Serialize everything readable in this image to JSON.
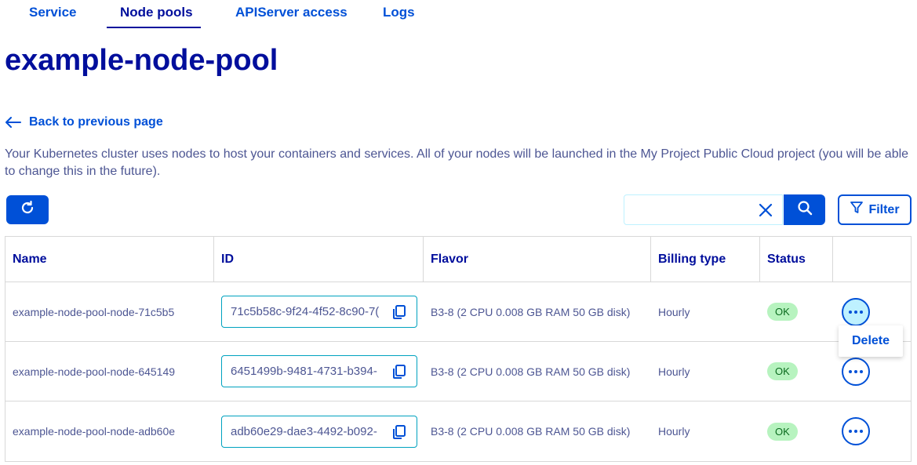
{
  "tabs": [
    {
      "label": "Service"
    },
    {
      "label": "Node pools"
    },
    {
      "label": "APIServer access"
    },
    {
      "label": "Logs"
    }
  ],
  "page_title": "example-node-pool",
  "back_link": "Back to previous page",
  "description": "Your Kubernetes cluster uses nodes to host your containers and services. All of your nodes will be launched in the My Project Public Cloud project (you will be able to change this in the future).",
  "toolbar": {
    "search_value": "",
    "filter_label": "Filter"
  },
  "table": {
    "headers": {
      "name": "Name",
      "id": "ID",
      "flavor": "Flavor",
      "billing": "Billing type",
      "status": "Status"
    },
    "rows": [
      {
        "name": "example-node-pool-node-71c5b5",
        "id": "71c5b58c-9f24-4f52-8c90-7(",
        "flavor": "B3-8 (2 CPU 0.008 GB RAM 50 GB disk)",
        "billing": "Hourly",
        "status": "OK"
      },
      {
        "name": "example-node-pool-node-645149",
        "id": "6451499b-9481-4731-b394-",
        "flavor": "B3-8 (2 CPU 0.008 GB RAM 50 GB disk)",
        "billing": "Hourly",
        "status": "OK"
      },
      {
        "name": "example-node-pool-node-adb60e",
        "id": "adb60e29-dae3-4492-b092-",
        "flavor": "B3-8 (2 CPU 0.008 GB RAM 50 GB disk)",
        "billing": "Hourly",
        "status": "OK"
      }
    ]
  },
  "action_menu": {
    "delete_label": "Delete"
  },
  "colors": {
    "primary": "#0050d7",
    "heading": "#000e9c",
    "text": "#4d5693",
    "status_ok_bg": "#b7f3bf",
    "status_ok_text": "#0a6b1e"
  }
}
